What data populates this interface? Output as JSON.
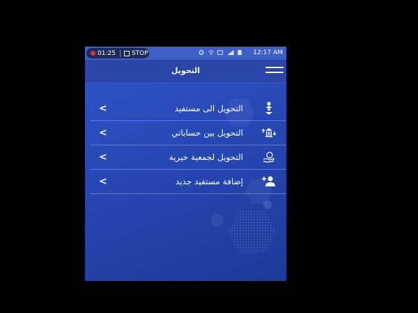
{
  "statusbar": {
    "record_time": "01:25",
    "stop_label": "STOP",
    "time": "12:17 AM",
    "icons": [
      "gear-icon",
      "wifi-icon",
      "network-icon",
      "signal-icon",
      "battery-icon"
    ]
  },
  "header": {
    "title": "التحويل",
    "menu_icon": "hamburger-menu-icon"
  },
  "menu": {
    "items": [
      {
        "label": "التحويل الى مستفيد",
        "icon": "person-transfer-icon"
      },
      {
        "label": "التحويل بين حساباتي",
        "icon": "bank-transfer-icon"
      },
      {
        "label": "التحويل لجمعية خيرية",
        "icon": "charity-hand-icon"
      },
      {
        "label": "إضافة مستفيد جديد",
        "icon": "add-user-icon"
      }
    ]
  },
  "colors": {
    "background": "#2648b4",
    "statusbar": "#3f5fc8",
    "appbar": "#2a46a8",
    "text": "#ffffff",
    "record_dot": "#e5322d"
  }
}
